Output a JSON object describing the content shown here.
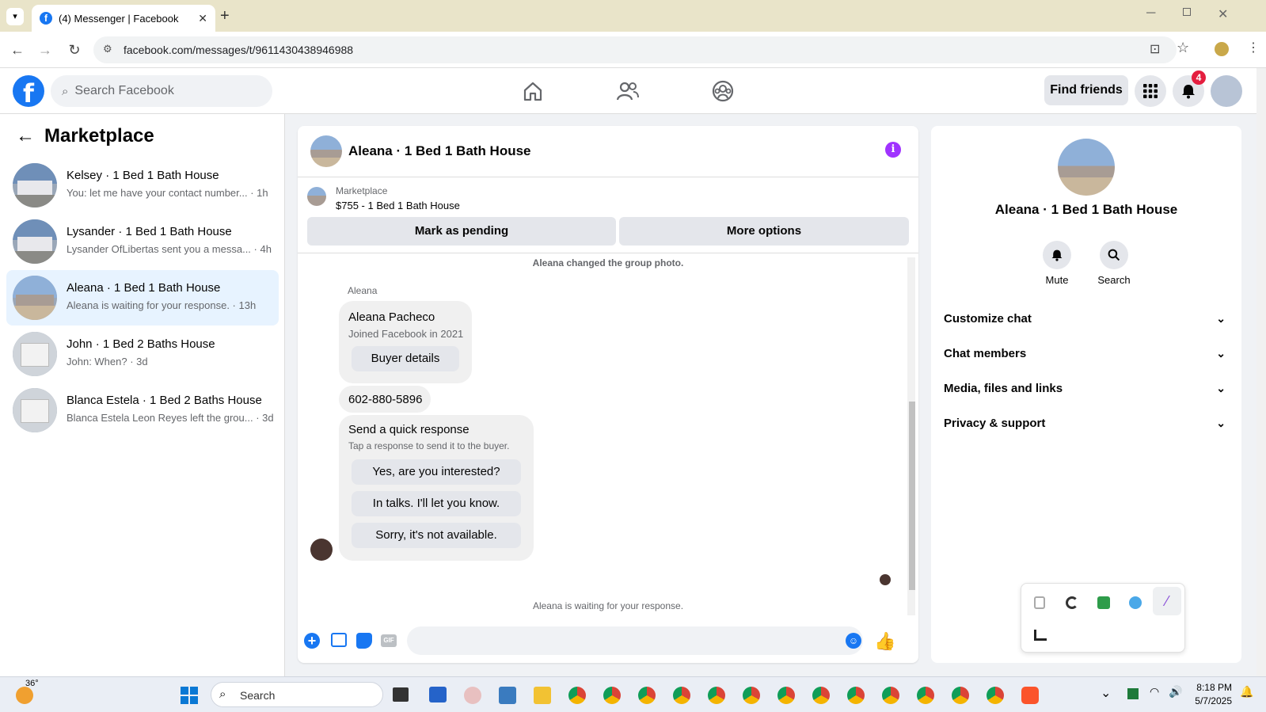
{
  "browser": {
    "tab_title": "(4) Messenger | Facebook",
    "url": "facebook.com/messages/t/9611430438946988"
  },
  "fb": {
    "search_placeholder": "Search Facebook",
    "find_friends": "Find friends",
    "notif_count": "4"
  },
  "left": {
    "title": "Marketplace",
    "conversations": [
      {
        "name": "Kelsey · 1 Bed 1 Bath House",
        "preview": "You: let me have your contact number... · 1h"
      },
      {
        "name": "Lysander · 1 Bed 1 Bath House",
        "preview": "Lysander OfLibertas sent you a messa... · 4h"
      },
      {
        "name": "Aleana · 1 Bed 1 Bath House",
        "preview": "Aleana is waiting for your response. · 13h"
      },
      {
        "name": "John · 1 Bed 2 Baths House",
        "preview": "John: When? · 3d"
      },
      {
        "name": "Blanca Estela · 1 Bed 2 Baths House",
        "preview": "Blanca Estela Leon Reyes left the grou... · 3d"
      }
    ]
  },
  "chat": {
    "title": "Aleana · 1 Bed 1 Bath House",
    "listing_label": "Marketplace",
    "listing_price": "$755 - 1 Bed 1 Bath House",
    "mark_pending": "Mark as pending",
    "more_options": "More options",
    "sys_photo": "Aleana changed the group photo.",
    "sender": "Aleana",
    "buyer_name": "Aleana Pacheco",
    "buyer_joined": "Joined Facebook in 2021",
    "buyer_details": "Buyer details",
    "phone": "602-880-5896",
    "quick_title": "Send a quick response",
    "quick_sub": "Tap a response to send it to the buyer.",
    "quick_1": "Yes, are you interested?",
    "quick_2": "In talks. I'll let you know.",
    "quick_3": "Sorry, it's not available.",
    "waiting": "Aleana is waiting for your response."
  },
  "right": {
    "name": "Aleana · 1 Bed 1 Bath House",
    "mute": "Mute",
    "search": "Search",
    "sections": [
      "Customize chat",
      "Chat members",
      "Media, files and links",
      "Privacy & support"
    ]
  },
  "taskbar": {
    "weather": "36°",
    "search": "Search",
    "time": "8:18 PM",
    "date": "5/7/2025"
  }
}
